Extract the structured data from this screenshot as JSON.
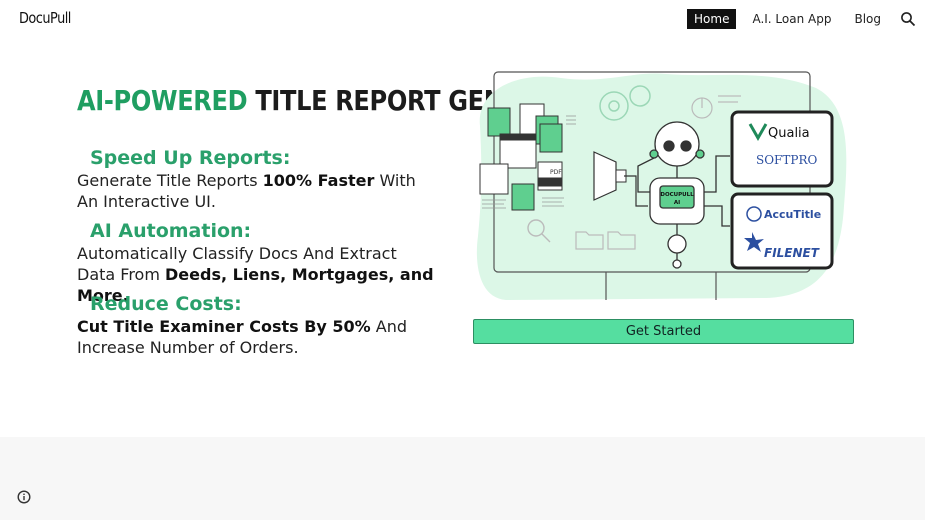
{
  "header": {
    "logo": "DocuPull",
    "nav": [
      {
        "label": "Home",
        "active": true
      },
      {
        "label": "A.I. Loan App",
        "active": false
      },
      {
        "label": "Blog",
        "active": false
      }
    ],
    "search_icon": "search-icon"
  },
  "hero": {
    "title_accent": "AI-POWERED",
    "title_rest": "TITLE REPORT GENERATION"
  },
  "features": [
    {
      "heading": "Speed Up Reports:",
      "text_pre": "Generate Title Reports ",
      "text_bold": "100% Faster",
      "text_post": " With An Interactive UI."
    },
    {
      "heading": "AI Automation:",
      "text_pre": "Automatically Classify Docs And Extract Data From ",
      "text_bold": "Deeds, Liens, Mortgages, and More.",
      "text_post": ""
    },
    {
      "heading": "Reduce Costs:",
      "text_pre": "",
      "text_bold": "Cut Title Examiner Costs By 50%",
      "text_post": " And Increase Number of Orders."
    }
  ],
  "illustration": {
    "robot_label_line1": "DOCUPULL",
    "robot_label_line2": "AI",
    "doc_tag": "PDF",
    "partners": [
      "Qualia",
      "SOFTPRO",
      "AccuTitle",
      "FILENET"
    ]
  },
  "cta": {
    "label": "Get Started"
  },
  "colors": {
    "accent": "#1f9e61",
    "button": "#55dea0",
    "blob": "#dcf7e7",
    "nav_active_bg": "#111111"
  },
  "footer_icon": "info-icon"
}
